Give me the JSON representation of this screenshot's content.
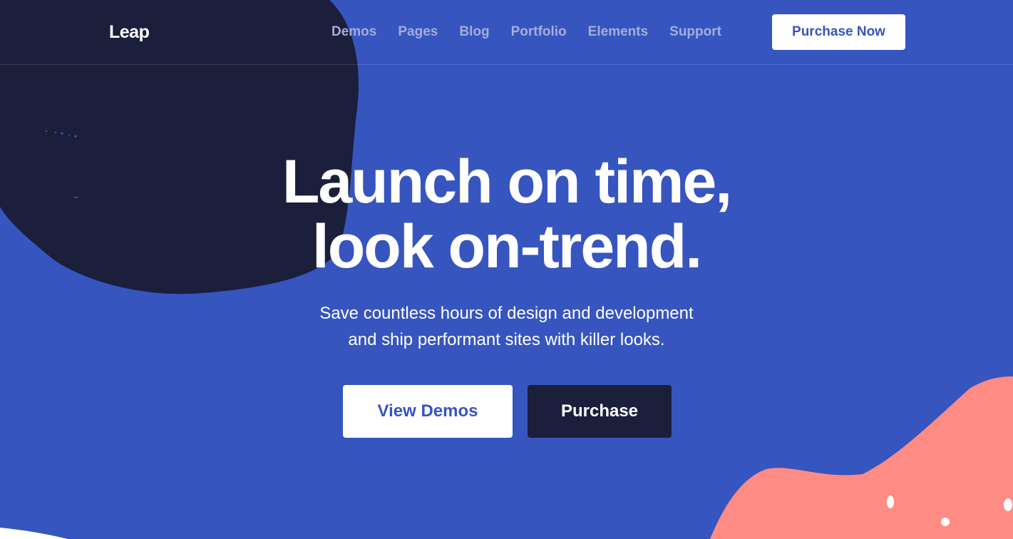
{
  "brand": {
    "logo_text": "Leap"
  },
  "nav": {
    "items": [
      {
        "label": "Demos"
      },
      {
        "label": "Pages"
      },
      {
        "label": "Blog"
      },
      {
        "label": "Portfolio"
      },
      {
        "label": "Elements"
      },
      {
        "label": "Support"
      }
    ],
    "cta_label": "Purchase Now"
  },
  "hero": {
    "title_line1": "Launch on time,",
    "title_line2": "look on-trend.",
    "subtitle_line1": "Save countless hours of design and development",
    "subtitle_line2": "and ship performant sites with killer looks.",
    "primary_button": "View Demos",
    "secondary_button": "Purchase"
  },
  "colors": {
    "background": "#3755be",
    "dark_blob": "#1b1f3b",
    "coral_blob": "#ff8c84",
    "nav_link": "#a3aedb",
    "white": "#ffffff"
  },
  "icons": []
}
